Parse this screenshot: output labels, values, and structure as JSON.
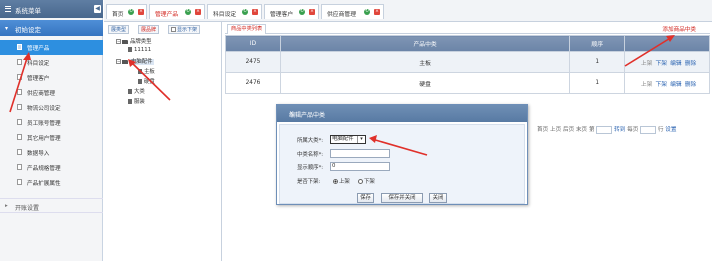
{
  "sidebar": {
    "title": "系统菜单",
    "collapse_glyph": "◀",
    "group1_label": "初始设定",
    "items": [
      {
        "label": "管理产品"
      },
      {
        "label": "科目设定"
      },
      {
        "label": "管理客户"
      },
      {
        "label": "供应商管理"
      },
      {
        "label": "物流公司设定"
      },
      {
        "label": "员工账号管理"
      },
      {
        "label": "其它用户管理"
      },
      {
        "label": "数据导入"
      },
      {
        "label": "产品规格管理"
      },
      {
        "label": "产品扩展属性"
      }
    ],
    "group2_label": "开账设置"
  },
  "tabs": [
    {
      "label": "首页"
    },
    {
      "label": "管理产品"
    },
    {
      "label": "科目设定"
    },
    {
      "label": "管理客户"
    },
    {
      "label": "供应商管理"
    }
  ],
  "tree": {
    "btn_expand": "展类型",
    "btn_brand": "展品牌",
    "btn_show_off": "显示下架",
    "nodes": {
      "root": "品牌类型",
      "n1": "11111",
      "n2": "电脑配件",
      "n2a": "主板",
      "n2b": "硬盘",
      "n3": "大类",
      "n4": "服装"
    }
  },
  "grid": {
    "title": "商品中类列表",
    "add_link": "添加商品中类",
    "headers": [
      "ID",
      "产品中类",
      "顺序",
      ""
    ],
    "rows": [
      {
        "id": "2475",
        "name": "主板",
        "order": "1",
        "actions": [
          "上架",
          "下架",
          "编辑",
          "删除"
        ]
      },
      {
        "id": "2476",
        "name": "硬盘",
        "order": "1",
        "actions": [
          "上架",
          "下架",
          "编辑",
          "删除"
        ]
      }
    ],
    "pager": {
      "first": "首页",
      "prev": "上页",
      "next": "后页",
      "last": "末页",
      "page_label": "第",
      "go": "转到",
      "per_page": "每页",
      "per_unit": "行",
      "set": "设置"
    }
  },
  "dialog": {
    "title": "编辑产品中类",
    "close_glyph": "×",
    "fields": {
      "category_label": "所属大类*:",
      "category_value": "电脑配件",
      "name_label": "中类名称*:",
      "name_value": "",
      "order_label": "显示顺序*:",
      "order_value": "0",
      "offshelf_label": "是否下架:",
      "opt_on": "上架",
      "opt_off": "下架"
    },
    "buttons": {
      "save": "保存",
      "save_close": "保存并关闭",
      "close": "关闭"
    }
  },
  "colors": {
    "accent_red": "#d2261f",
    "active_blue": "#2d8fe0",
    "header_blue": "#6b84a7"
  }
}
